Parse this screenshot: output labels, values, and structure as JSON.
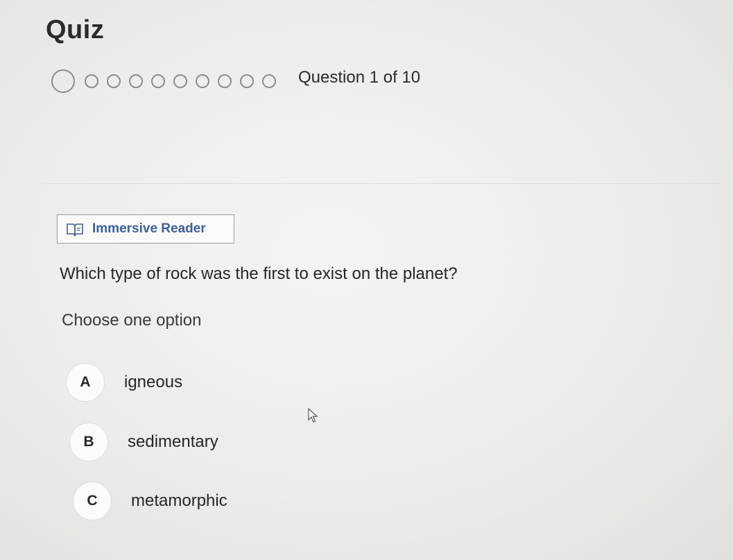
{
  "header": {
    "title": "Quiz"
  },
  "progress": {
    "text": "Question 1 of 10",
    "total": 10,
    "current": 1
  },
  "reader": {
    "label": "Immersive Reader",
    "icon": "immersive-reader-icon"
  },
  "question": {
    "text": "Which type of rock was the first to exist on the planet?",
    "instruction": "Choose one option",
    "options": [
      {
        "letter": "A",
        "text": "igneous"
      },
      {
        "letter": "B",
        "text": "sedimentary"
      },
      {
        "letter": "C",
        "text": "metamorphic"
      }
    ]
  },
  "colors": {
    "accent": "#3a5f9c",
    "text": "#262626",
    "border": "#8c8c8c"
  }
}
